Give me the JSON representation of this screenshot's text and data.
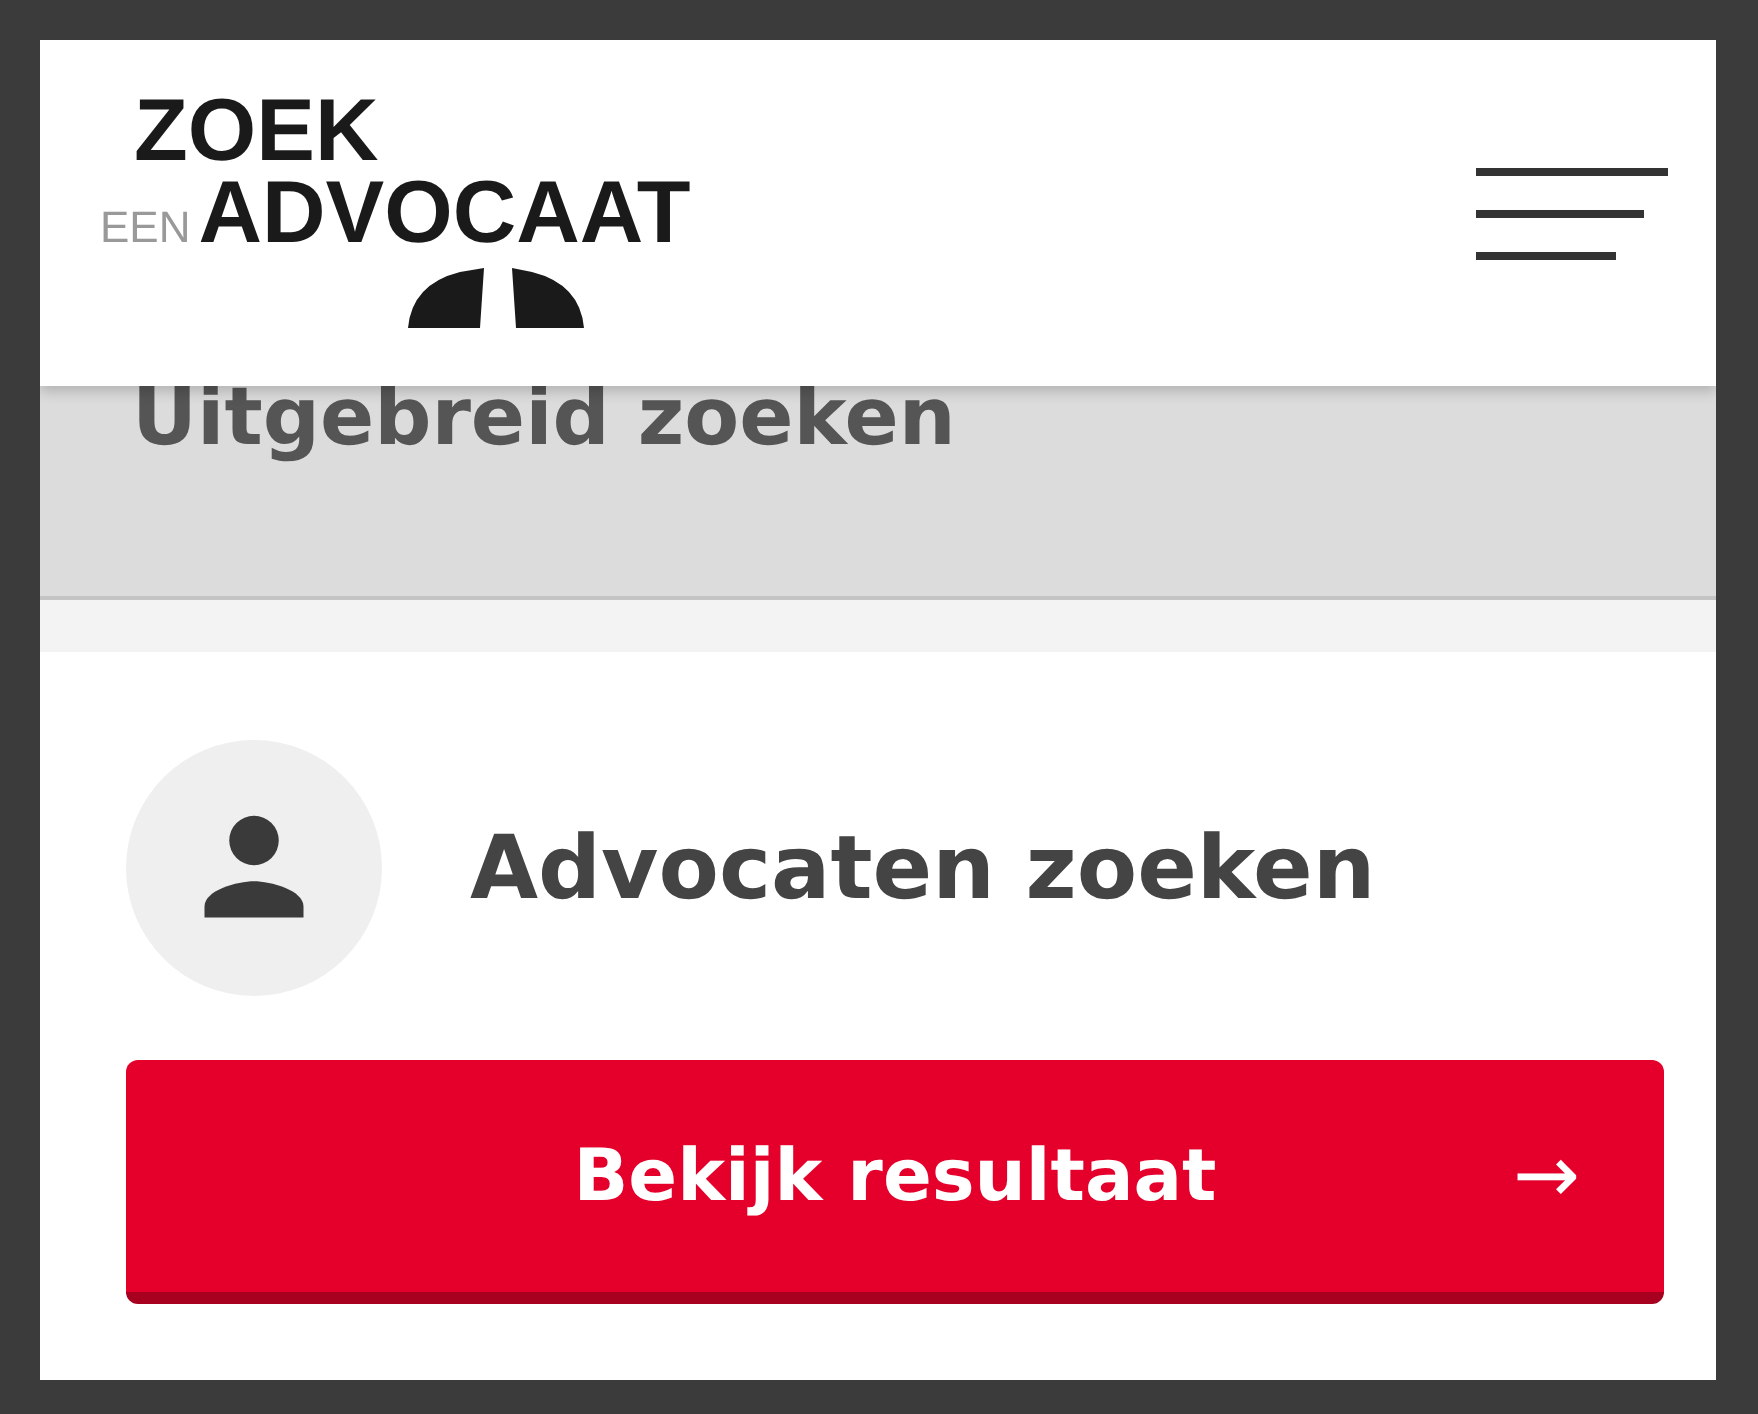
{
  "header": {
    "logo": {
      "top": "ZOEK",
      "prefix": "EEN",
      "main": "ADVOCAAT"
    }
  },
  "section_heading": "Uitgebreid zoeken",
  "card": {
    "title": "Advocaten zoeken",
    "button": {
      "label": "Bekijk resultaat",
      "arrow": "→"
    }
  }
}
